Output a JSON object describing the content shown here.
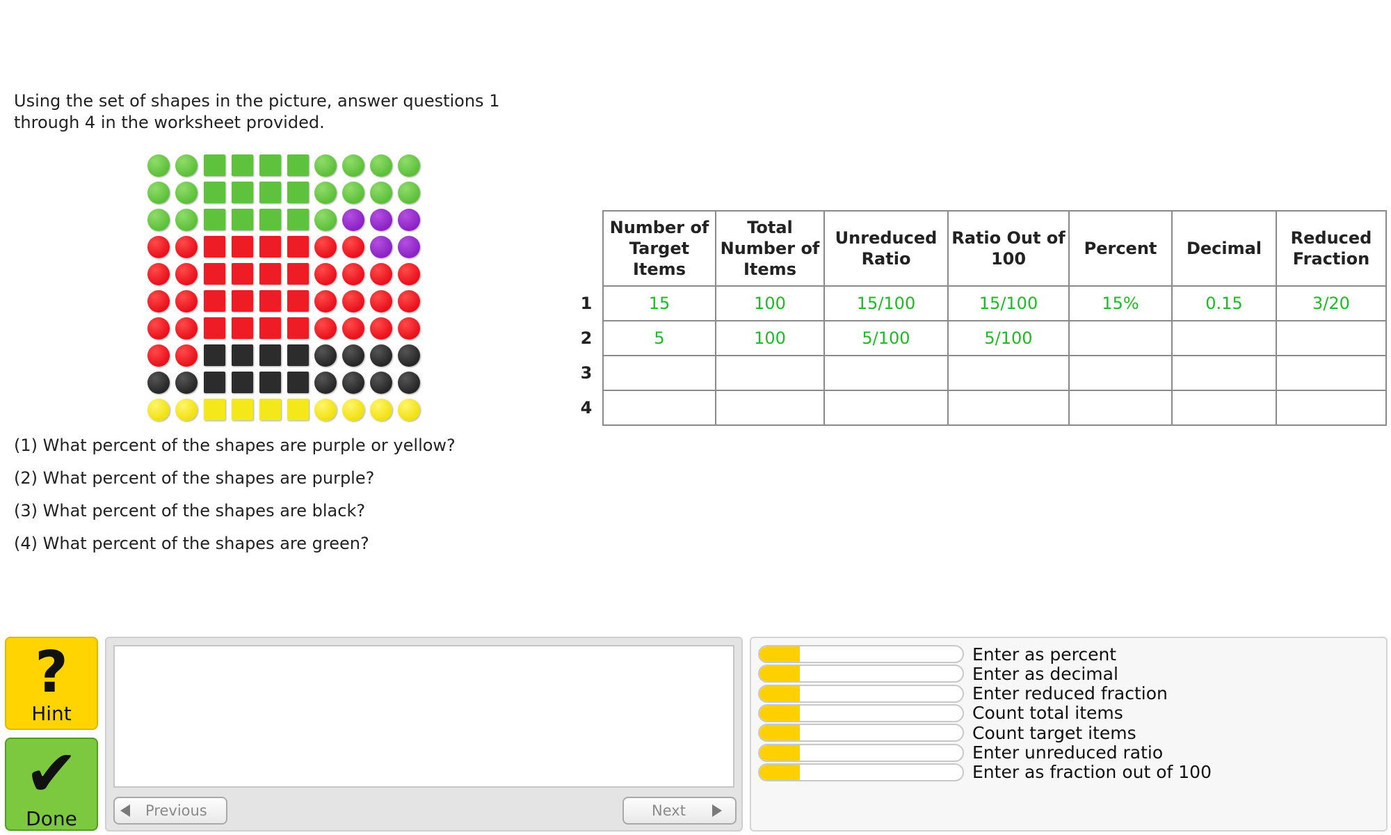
{
  "instructions": "Using the set of shapes in the picture, answer questions 1 through 4 in the worksheet provided.",
  "shape_grid": {
    "rows": [
      [
        "green-circle",
        "green-circle",
        "green-square",
        "green-square",
        "green-square",
        "green-square",
        "green-circle",
        "green-circle",
        "green-circle",
        "green-circle"
      ],
      [
        "green-circle",
        "green-circle",
        "green-square",
        "green-square",
        "green-square",
        "green-square",
        "green-circle",
        "green-circle",
        "green-circle",
        "green-circle"
      ],
      [
        "green-circle",
        "green-circle",
        "green-square",
        "green-square",
        "green-square",
        "green-square",
        "green-circle",
        "purple-circle",
        "purple-circle",
        "purple-circle"
      ],
      [
        "red-circle",
        "red-circle",
        "red-square",
        "red-square",
        "red-square",
        "red-square",
        "red-circle",
        "red-circle",
        "purple-circle",
        "purple-circle"
      ],
      [
        "red-circle",
        "red-circle",
        "red-square",
        "red-square",
        "red-square",
        "red-square",
        "red-circle",
        "red-circle",
        "red-circle",
        "red-circle"
      ],
      [
        "red-circle",
        "red-circle",
        "red-square",
        "red-square",
        "red-square",
        "red-square",
        "red-circle",
        "red-circle",
        "red-circle",
        "red-circle"
      ],
      [
        "red-circle",
        "red-circle",
        "red-square",
        "red-square",
        "red-square",
        "red-square",
        "red-circle",
        "red-circle",
        "red-circle",
        "red-circle"
      ],
      [
        "red-circle",
        "red-circle",
        "black-square",
        "black-square",
        "black-square",
        "black-square",
        "black-circle",
        "black-circle",
        "black-circle",
        "black-circle"
      ],
      [
        "black-circle",
        "black-circle",
        "black-square",
        "black-square",
        "black-square",
        "black-square",
        "black-circle",
        "black-circle",
        "black-circle",
        "black-circle"
      ],
      [
        "yellow-circle",
        "yellow-circle",
        "yellow-square",
        "yellow-square",
        "yellow-square",
        "yellow-square",
        "yellow-circle",
        "yellow-circle",
        "yellow-circle",
        "yellow-circle"
      ]
    ],
    "colors": {
      "green": "#5cbf3a",
      "purple": "#8a22c4",
      "red": "#e8101c",
      "black": "#262626",
      "yellow": "#f0e010"
    }
  },
  "questions": [
    "(1) What percent of the shapes are purple or yellow?",
    "(2) What percent of the shapes are purple?",
    "(3) What percent of the shapes are black?",
    "(4) What percent of the shapes are green?"
  ],
  "worksheet": {
    "headers": [
      "Number of Target Items",
      "Total Number of Items",
      "Unreduced Ratio",
      "Ratio Out of 100",
      "Percent",
      "Decimal",
      "Reduced Fraction"
    ],
    "rows": [
      {
        "num": "1",
        "cells": [
          "15",
          "100",
          "15/100",
          "15/100",
          "15%",
          "0.15",
          "3/20"
        ]
      },
      {
        "num": "2",
        "cells": [
          "5",
          "100",
          "5/100",
          "5/100",
          "",
          "",
          ""
        ]
      },
      {
        "num": "3",
        "cells": [
          "",
          "",
          "",
          "",
          "",
          "",
          ""
        ]
      },
      {
        "num": "4",
        "cells": [
          "",
          "",
          "",
          "",
          "",
          "",
          ""
        ]
      }
    ],
    "answer_color": "#22b829"
  },
  "buttons": {
    "hint_label": "Hint",
    "hint_icon": "question-mark-icon",
    "done_label": "Done",
    "done_icon": "checkmark-icon",
    "previous_label": "Previous",
    "next_label": "Next"
  },
  "skills": [
    {
      "label": "Enter as percent",
      "progress": 0.2
    },
    {
      "label": "Enter as decimal",
      "progress": 0.2
    },
    {
      "label": "Enter reduced fraction",
      "progress": 0.2
    },
    {
      "label": "Count total items",
      "progress": 0.2
    },
    {
      "label": "Count target items",
      "progress": 0.2
    },
    {
      "label": "Enter unreduced ratio",
      "progress": 0.2
    },
    {
      "label": "Enter as fraction out of 100",
      "progress": 0.2
    }
  ],
  "skill_color": "#ffd000"
}
